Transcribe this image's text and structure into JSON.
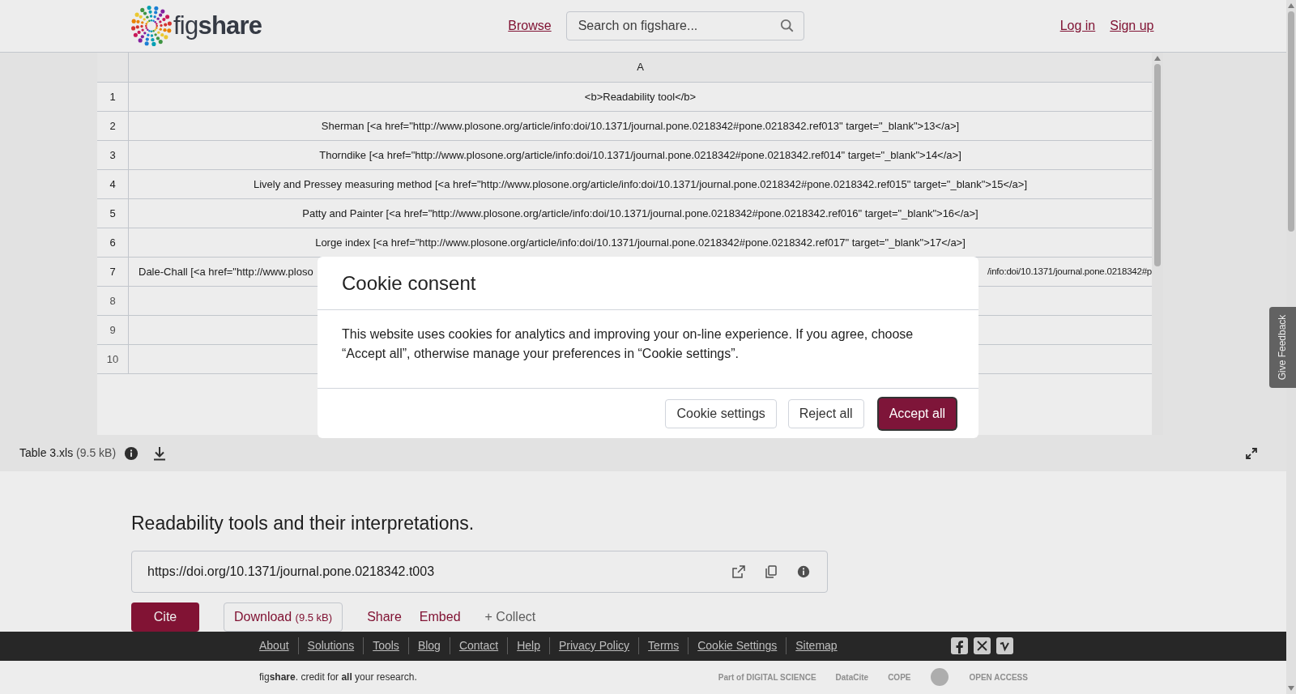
{
  "header": {
    "logo": {
      "text_plain": "fig",
      "text_bold": "share"
    },
    "nav": [
      {
        "label": "Browse"
      }
    ],
    "search": {
      "placeholder": "Search on figshare..."
    },
    "account": [
      {
        "label": "Log in"
      },
      {
        "label": "Sign up"
      }
    ]
  },
  "sheet": {
    "columns": [
      "A"
    ],
    "rows": [
      {
        "number": "1",
        "kind": "full",
        "text": "<b>Readability tool</b>"
      },
      {
        "number": "2",
        "kind": "full",
        "text": "Sherman [<a href=\"http://www.plosone.org/article/info:doi/10.1371/journal.pone.0218342#pone.0218342.ref013\" target=\"_blank\">13</a>]"
      },
      {
        "number": "3",
        "kind": "full",
        "text": "Thorndike [<a href=\"http://www.plosone.org/article/info:doi/10.1371/journal.pone.0218342#pone.0218342.ref014\" target=\"_blank\">14</a>]"
      },
      {
        "number": "4",
        "kind": "full",
        "text": "Lively and Pressey measuring method [<a href=\"http://www.plosone.org/article/info:doi/10.1371/journal.pone.0218342#pone.0218342.ref015\" target=\"_blank\">15</a>]"
      },
      {
        "number": "5",
        "kind": "full",
        "text": "Patty and Painter [<a href=\"http://www.plosone.org/article/info:doi/10.1371/journal.pone.0218342#pone.0218342.ref016\" target=\"_blank\">16</a>]"
      },
      {
        "number": "6",
        "kind": "full",
        "text": "Lorge index [<a href=\"http://www.plosone.org/article/info:doi/10.1371/journal.pone.0218342#pone.0218342.ref017\" target=\"_blank\">17</a>]"
      },
      {
        "number": "7",
        "kind": "split",
        "text_left": "Dale-Chall [<a href=\"http://www.ploso",
        "text_right": "/info:doi/10.1371/journal.pone.0218342#p"
      },
      {
        "number": "8",
        "kind": "faded"
      },
      {
        "number": "9",
        "kind": "faded"
      },
      {
        "number": "10",
        "kind": "faded"
      }
    ],
    "file_name": "Table 3.xls",
    "file_size": "(9.5 kB)"
  },
  "item": {
    "title": "Readability tools and their interpretations.",
    "doi": "https://doi.org/10.1371/journal.pone.0218342.t003",
    "actions": [
      {
        "kind": "primary",
        "label": "Cite"
      },
      {
        "kind": "outlined",
        "label": "Download",
        "extra": "(9.5 kB)"
      },
      {
        "kind": "link",
        "label": "Share"
      },
      {
        "kind": "link",
        "label": "Embed"
      },
      {
        "kind": "muted",
        "label": "+ Collect"
      }
    ]
  },
  "footer": {
    "links": [
      "About",
      "Solutions",
      "Tools",
      "Blog",
      "Contact",
      "Help",
      "Privacy Policy",
      "Terms",
      "Cookie Settings",
      "Sitemap"
    ],
    "tagline": "fig**share**. credit for **all** your research.",
    "partners": [
      "Part of DIGITAL SCIENCE",
      "DataCite",
      "COPE",
      "OPEN ACCESS"
    ]
  },
  "feedback_tab": "Give Feedback",
  "cookie_dialog": {
    "title": "Cookie consent",
    "text": "This website uses cookies for analytics and improving your on-line experience. If you agree, choose “Accept all”, otherwise manage your preferences in “Cookie settings”.",
    "buttons": [
      {
        "kind": "secondary",
        "label": "Cookie settings"
      },
      {
        "kind": "secondary",
        "label": "Reject all"
      },
      {
        "kind": "primary",
        "label": "Accept all"
      }
    ]
  }
}
